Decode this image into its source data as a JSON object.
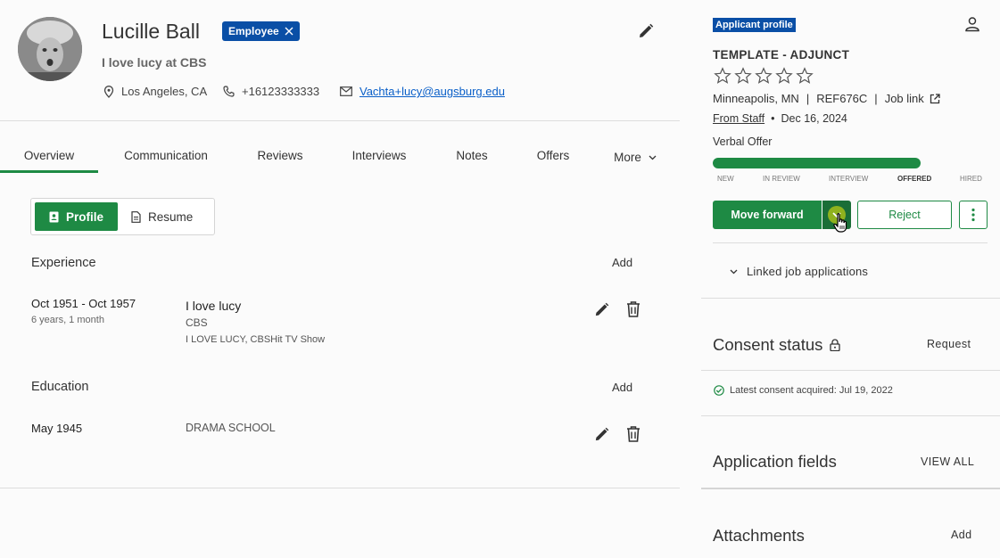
{
  "profile": {
    "name": "Lucille Ball",
    "badge": "Employee",
    "headline": "I love lucy at CBS",
    "location": "Los Angeles, CA",
    "phone": "+16123333333",
    "email": "Vachta+lucy@augsburg.edu"
  },
  "tabs": [
    "Overview",
    "Communication",
    "Reviews",
    "Interviews",
    "Notes",
    "Offers",
    "More"
  ],
  "toggle": {
    "profile": "Profile",
    "resume": "Resume"
  },
  "experience": {
    "title": "Experience",
    "add": "Add",
    "entries": [
      {
        "dates": "Oct 1951 - Oct 1957",
        "duration": "6 years, 1 month",
        "title": "I love lucy",
        "company": "CBS",
        "description": "I LOVE LUCY, CBSHit TV Show"
      }
    ]
  },
  "education": {
    "title": "Education",
    "add": "Add",
    "entries": [
      {
        "date": "May 1945",
        "school": "DRAMA SCHOOL"
      }
    ]
  },
  "application": {
    "badge": "Applicant profile",
    "job_title": "TEMPLATE - ADJUNCT",
    "rating": 0,
    "location": "Minneapolis, MN",
    "ref": "REF676C",
    "job_link": "Job link",
    "source": "From Staff",
    "date": "Dec 16, 2024",
    "stage": "Verbal Offer",
    "progress_fraction": 0.8,
    "stages": [
      "NEW",
      "IN REVIEW",
      "INTERVIEW",
      "OFFERED",
      "HIRED"
    ],
    "current_stage": "OFFERED",
    "move_forward": "Move forward",
    "reject": "Reject",
    "linked": "Linked job applications"
  },
  "consent": {
    "title": "Consent status",
    "action": "Request",
    "latest": "Latest consent acquired: Jul 19, 2022"
  },
  "fields": {
    "title": "Application fields",
    "action": "VIEW ALL"
  },
  "attachments": {
    "title": "Attachments",
    "action": "Add"
  },
  "colors": {
    "green": "#1e8a44",
    "blue": "#0a4fa6",
    "link": "#0a5fc8"
  }
}
